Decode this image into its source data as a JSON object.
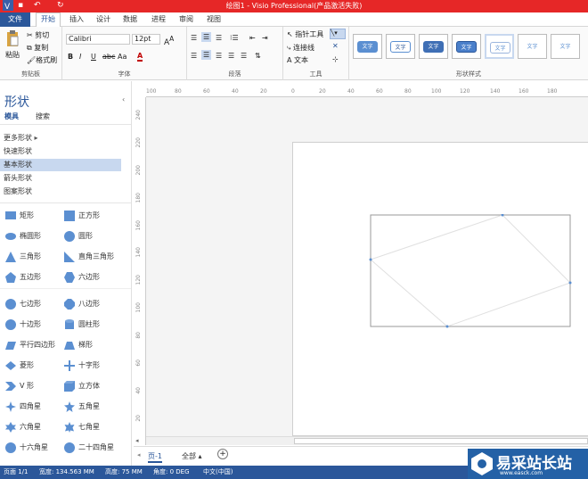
{
  "window": {
    "title": "绘图1 - Visio Professional(产品激活失败)"
  },
  "menu_tabs": [
    "文件",
    "开始",
    "插入",
    "设计",
    "数据",
    "进程",
    "审阅",
    "视图"
  ],
  "clipboard": {
    "paste": "粘贴",
    "cut": "剪切",
    "copy": "复制",
    "format_painter": "格式刷",
    "label": "剪贴板"
  },
  "font": {
    "name": "Calibri",
    "size": "12pt",
    "label": "字体",
    "bold": "B",
    "italic": "I",
    "underline": "U",
    "strike": "abc",
    "case": "Aa",
    "color": "A"
  },
  "paragraph": {
    "label": "段落"
  },
  "tools": {
    "pointer": "指针工具",
    "connector": "连接线",
    "text": "文本",
    "label": "工具"
  },
  "shape_styles": {
    "label": "形状样式",
    "sample_text": "文字"
  },
  "shapes_pane": {
    "title": "形状",
    "tab_stencils": "模具",
    "tab_search": "搜索",
    "more_shapes": "更多形状"
  },
  "stencils": [
    "快速形状",
    "基本形状",
    "箭头形状",
    "图案形状"
  ],
  "shapes": [
    [
      "矩形",
      "正方形"
    ],
    [
      "椭圆形",
      "圆形"
    ],
    [
      "三角形",
      "直角三角形"
    ],
    [
      "五边形",
      "六边形"
    ],
    [
      "七边形",
      "八边形"
    ],
    [
      "十边形",
      "圆柱形"
    ],
    [
      "平行四边形",
      "梯形"
    ],
    [
      "菱形",
      "十字形"
    ],
    [
      "V 形",
      "立方体"
    ],
    [
      "四角星",
      "五角星"
    ],
    [
      "六角星",
      "七角星"
    ],
    [
      "十六角星",
      "二十四角星"
    ]
  ],
  "ruler": {
    "h_ticks": [
      "100",
      "80",
      "60",
      "40",
      "20",
      "0",
      "20",
      "40",
      "60",
      "80",
      "100",
      "120",
      "140",
      "160",
      "180"
    ],
    "v_ticks": [
      "240",
      "220",
      "200",
      "180",
      "160",
      "140",
      "120",
      "100",
      "80",
      "60",
      "40",
      "20"
    ]
  },
  "page_tabs": {
    "page": "页-1",
    "all": "全部",
    "add": "+"
  },
  "status": {
    "page": "页面 1/1",
    "width": "宽度: 134.563 MM",
    "height": "高度: 75 MM",
    "angle": "角度: 0 DEG",
    "lang": "中文(中国)"
  },
  "logo_text": "易采站长站",
  "logo_url": "www.easck.com"
}
